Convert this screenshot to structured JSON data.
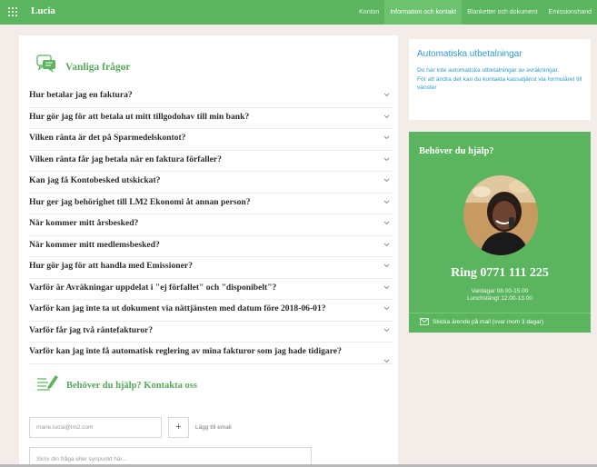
{
  "topbar": {
    "brand": "Lucia",
    "nav": [
      "Konton",
      "Information och kontakt",
      "Blanketter och dokument",
      "Emissionshand"
    ],
    "active_index": 1,
    "icon": "grid-icon",
    "color": "#5ab55e"
  },
  "faq": {
    "title": "Vanliga frågor",
    "icon": "faq-chat-icon",
    "questions": [
      "Hur betalar jag en faktura?",
      "Hur gör jag för att betala ut mitt tillgodohav till min bank?",
      "Vilken ränta är det på Sparmedelskontot?",
      "Vilken ränta får jag betala när en faktura förfaller?",
      "Kan jag få Kontobesked utskickat?",
      "Hur ger jag behörighet till LM2 Ekonomi åt annan person?",
      "När kommer mitt årsbesked?",
      "När kommer mitt medlemsbesked?",
      "Hur gör jag för att handla med Emissioner?",
      "Varför är Avräkningar uppdelat i \"ej förfallet\" och \"disponibelt\"?",
      "Varför kan jag inte ta ut dokument via nättjänsten med datum före 2018-06-01?",
      "Varför får jag två räntefakturor?",
      "Varför kan jag inte få automatisk reglering av mina fakturor som jag hade tidigare?"
    ]
  },
  "contact": {
    "title": "Behöver du hjälp? Kontakta oss",
    "icon": "contact-pen-icon",
    "email_value": "marie.lucia@lm2.com",
    "plus_label": "+",
    "add_email_label": "Lägg till email",
    "message_placeholder": "Skriv din fråga eller synpunkt här..."
  },
  "auto_payments": {
    "title": "Automatiska utbetalningar",
    "text": "Du har inte automatiska utbetalningar av avräkningar.",
    "text2": "För att ändra det kan du kontakta kassaljänst via formuläret till vänster"
  },
  "help": {
    "title": "Behöver du hjälp?",
    "phone": "Ring 0771 111 225",
    "hours_weekdays": "Vardagar 08.00-15.00",
    "hours_lunch": "Lunchstängt 12.00-13.00",
    "mail_text": "Skicka ärende på mail (svar inom 3 dagar)",
    "mail_icon": "mail-icon",
    "avatar": "support-agent-avatar"
  }
}
